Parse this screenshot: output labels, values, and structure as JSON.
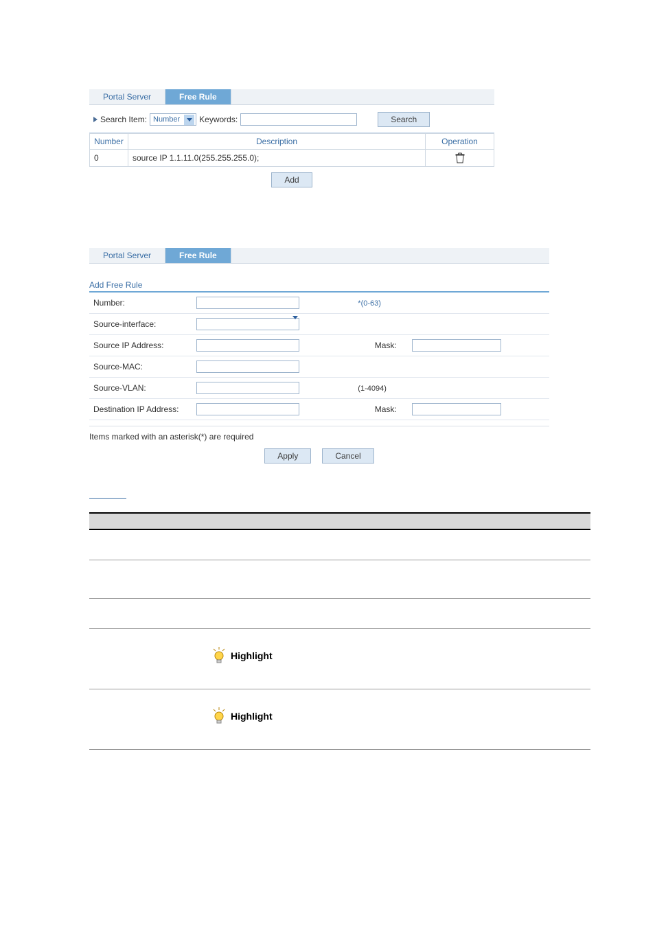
{
  "fig1": {
    "tabs": {
      "portal": "Portal Server",
      "free": "Free Rule"
    },
    "search": {
      "label": "Search Item:",
      "select": "Number",
      "kw_label": "Keywords:",
      "button": "Search"
    },
    "grid": {
      "cols": {
        "number": "Number",
        "description": "Description",
        "operation": "Operation"
      },
      "rows": [
        {
          "number": "0",
          "description": "source IP 1.1.11.0(255.255.255.0);"
        }
      ],
      "add": "Add"
    }
  },
  "fig2": {
    "tabs": {
      "portal": "Portal Server",
      "free": "Free Rule"
    },
    "title": "Add Free Rule",
    "fields": {
      "number": {
        "label": "Number:",
        "hint": "*(0-63)"
      },
      "srcif": {
        "label": "Source-interface:"
      },
      "srcip": {
        "label": "Source IP Address:",
        "mask": "Mask:"
      },
      "srcmac": {
        "label": "Source-MAC:"
      },
      "srcvlan": {
        "label": "Source-VLAN:",
        "hint": "(1-4094)"
      },
      "dstip": {
        "label": "Destination IP Address:",
        "mask": "Mask:"
      }
    },
    "required_note": "Items marked with an asterisk(*) are required",
    "buttons": {
      "apply": "Apply",
      "cancel": "Cancel"
    }
  },
  "desc": {
    "highlight": "Highlight"
  }
}
